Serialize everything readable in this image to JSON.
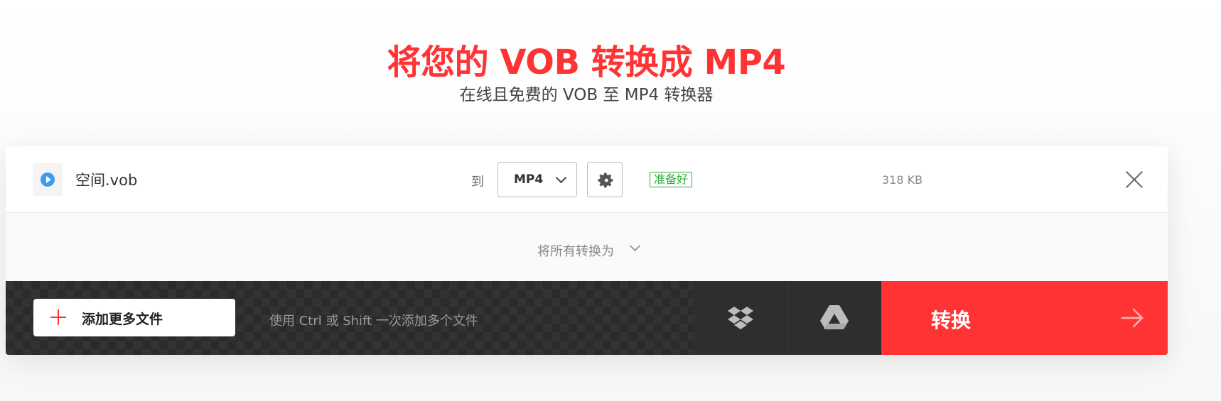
{
  "hero": {
    "title": "将您的 VOB 转换成 MP4",
    "subtitle": "在线且免费的 VOB 至 MP4 转换器"
  },
  "file": {
    "icon": "play-icon",
    "name": "空间.vob",
    "to_label": "到",
    "format": "MP4",
    "status": "准备好",
    "size": "318 KB"
  },
  "convert_all": {
    "label": "将所有转换为"
  },
  "toolbar": {
    "add_files_label": "添加更多文件",
    "hint": "使用 Ctrl 或 Shift 一次添加多个文件",
    "convert_label": "转换"
  },
  "colors": {
    "accent": "#ff3333",
    "ready": "#2eaa3c",
    "toolbar_bg": "#333333",
    "play_icon": "#3b9cf0"
  }
}
